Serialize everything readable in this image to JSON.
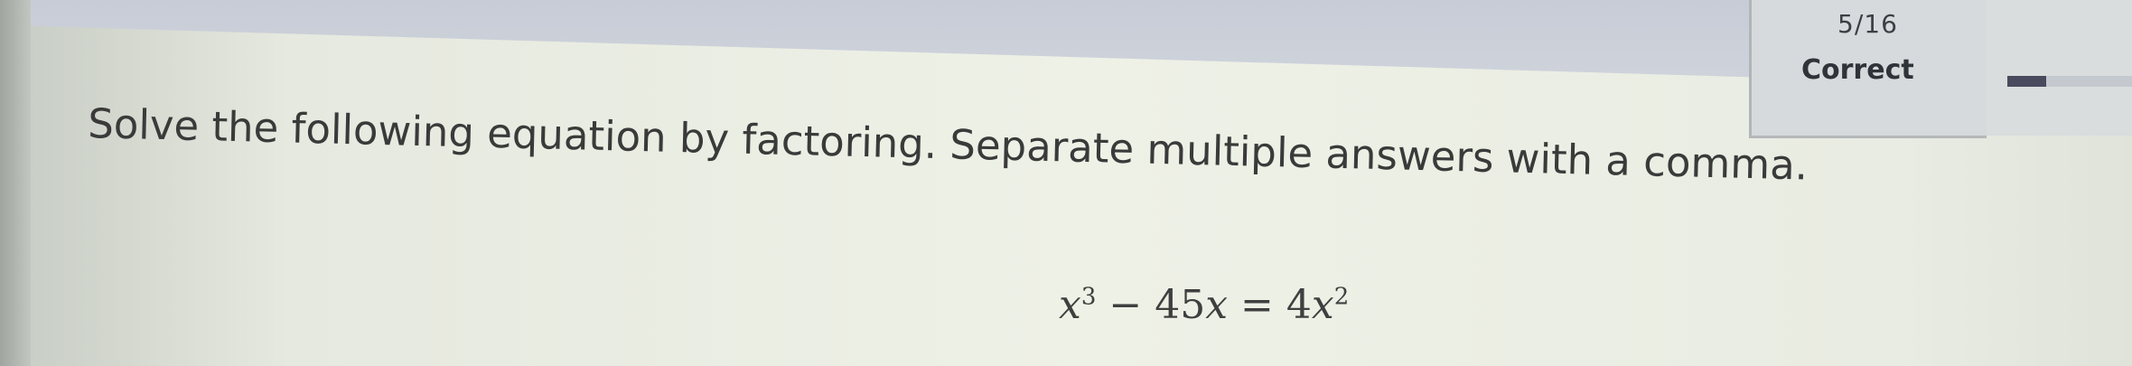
{
  "header": {
    "progress_count": "5/16",
    "status": "Correct",
    "progress_fraction": 0.3125
  },
  "question": {
    "prompt": "Solve the following equation by factoring. Separate multiple answers with a comma.",
    "equation": {
      "lhs_base": "x",
      "lhs_exp": "3",
      "middle": " − 45",
      "middle_var": "x",
      "equals": " = 4",
      "rhs_var": "x",
      "rhs_exp": "2"
    }
  },
  "colors": {
    "status_text": "#2f343a",
    "progress_fill": "#4a4a5e"
  }
}
